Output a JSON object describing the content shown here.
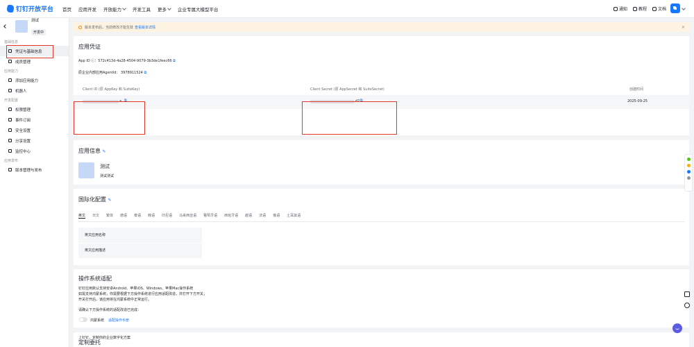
{
  "header": {
    "logo_text": "钉钉开放平台",
    "nav": [
      {
        "label": "首页",
        "has_caret": false
      },
      {
        "label": "应用开发",
        "has_caret": false
      },
      {
        "label": "开放能力",
        "has_caret": true
      },
      {
        "label": "开发工具",
        "has_caret": false
      },
      {
        "label": "更多",
        "has_caret": true
      },
      {
        "label": "企业专属大模型平台",
        "has_caret": false
      }
    ],
    "tools": {
      "notify": "通知",
      "tutorial": "教程",
      "docs": "文档"
    }
  },
  "sidebar": {
    "app_name": "测试",
    "app_status": "开发中",
    "groups": {
      "basic": "基础信息",
      "ability": "应用能力",
      "dev_config": "开发配置",
      "release": "应用发布"
    },
    "items": {
      "credentials": "凭证与基础信息",
      "members": "成员管理",
      "add_ability": "添加应用能力",
      "robot": "机器人",
      "permissions": "权限管理",
      "events": "事件订阅",
      "security": "安全设置",
      "share": "分享设置",
      "monitor": "监控中心",
      "versions": "版本管理与发布"
    }
  },
  "notice": {
    "text": "版本发布后，当前修改才能生效",
    "link": "查看版本详情"
  },
  "credentials": {
    "title": "应用凭证",
    "app_id_label": "App ID ⓘ：",
    "app_id_value": "572c413d-4a28-4504-9079-3b3de1feec66",
    "agent_label": "原企业内部应用AgentId：",
    "agent_value": "3978911524",
    "col_client_id": "Client ID (原 AppKey 和 SuiteKey)",
    "col_client_secret": "Client Secret (原 AppSecret 和 SuiteSecret)",
    "col_created": "创建时间",
    "client_id_tail": "a",
    "client_secret_tail": "d2",
    "created_value": "2025-09-25"
  },
  "app_info": {
    "title": "应用信息",
    "name": "测试",
    "desc": "测试测试"
  },
  "i18n": {
    "title": "国际化配置",
    "tabs": [
      "英文",
      "日文",
      "繁体",
      "德语",
      "泰语",
      "韩语",
      "印尼语",
      "马来西亚语",
      "葡萄牙语",
      "西班牙语",
      "越语",
      "法语",
      "俄语",
      "土耳其语"
    ],
    "rows": [
      "英文应用名称",
      "英文应用描述"
    ]
  },
  "os": {
    "title": "操作系统适配",
    "line1": "钉钉应用默认支持安卓Android、苹果iOS、Windows、苹果Mac操作系统",
    "line2": "如需支持鸿蒙系统，你需要根据下方操作系统进行应用适配改造，并打开下方开关；",
    "line3": "开关打开后，该应用将在鸿蒙系统中正常运行。",
    "confirm": "请确认下方操作系统的适配改造已完成：",
    "harmony_label": "鸿蒙系统",
    "manual_link": "适配操作手册",
    "harmony_enabled": false
  },
  "custom": {
    "title": "定制委托",
    "desc": "上钉钉，定制你的企业数字化方案"
  }
}
